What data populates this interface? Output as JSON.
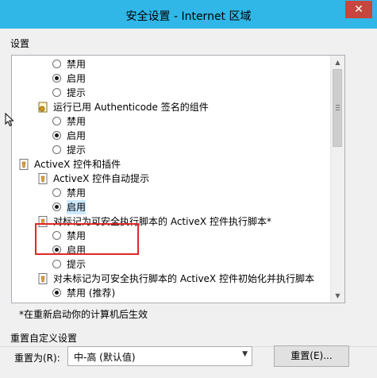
{
  "window": {
    "title": "安全设置 - Internet 区域",
    "close_glyph": "✕"
  },
  "settings_label": "设置",
  "tree": {
    "r0": "禁用",
    "r1": "启用",
    "r2": "提示",
    "authenticode": "运行已用 Authenticode 签名的组件",
    "r3": "禁用",
    "r4": "启用",
    "r5": "提示",
    "activex": "ActiveX 控件和插件",
    "autoprompt": "ActiveX 控件自动提示",
    "r6": "禁用",
    "r7": "启用",
    "safe_script": "对标记为可安全执行脚本的 ActiveX 控件执行脚本*",
    "r8": "禁用",
    "r9": "启用",
    "r10": "提示",
    "unsafe_init": "对未标记为可安全执行脚本的 ActiveX 控件初始化并执行脚本",
    "r11": "禁用 (推荐)"
  },
  "restart_note": "*在重新启动你的计算机后生效",
  "reset": {
    "group_label": "重置自定义设置",
    "reset_to_label": "重置为(R):",
    "selected_level": "中-高 (默认值)",
    "button_label": "重置(E)..."
  },
  "colors": {
    "titlebar": "#30b7e7",
    "highlight": "#e02828"
  }
}
